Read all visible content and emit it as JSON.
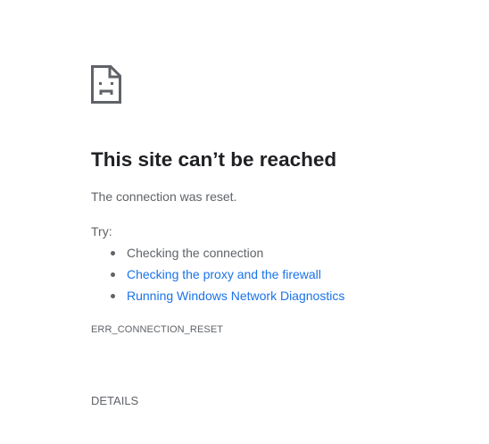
{
  "icon": {
    "name": "sad-page-icon"
  },
  "title": "This site can’t be reached",
  "message": "The connection was reset.",
  "try_label": "Try:",
  "suggestions": [
    {
      "label": "Checking the connection",
      "link": false
    },
    {
      "label": "Checking the proxy and the firewall",
      "link": true
    },
    {
      "label": "Running Windows Network Diagnostics",
      "link": true
    }
  ],
  "error_code": "ERR_CONNECTION_RESET",
  "details_label": "DETAILS",
  "colors": {
    "title": "#202124",
    "body_text": "#5f6368",
    "link": "#1a73e8",
    "icon": "#5f6368"
  }
}
